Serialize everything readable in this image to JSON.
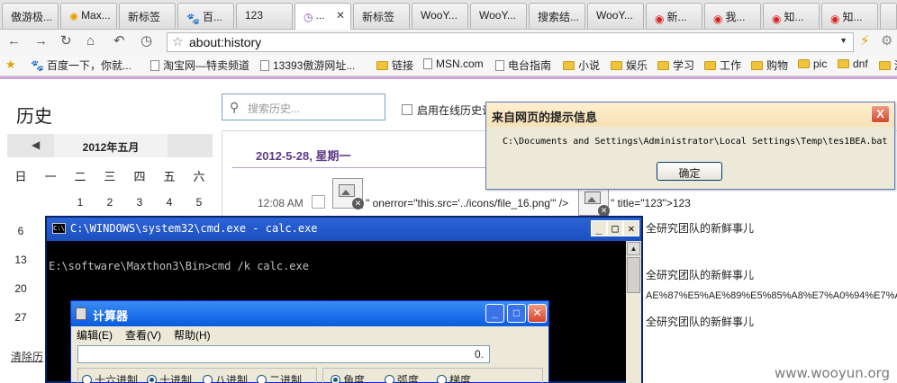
{
  "tabs": [
    {
      "label": "傲游极...",
      "icon": "favicon-icon"
    },
    {
      "label": "Max...",
      "icon": "maxthon-icon"
    },
    {
      "label": "新标签",
      "icon": ""
    },
    {
      "label": "百...",
      "icon": "baidu-paw-icon"
    },
    {
      "label": "123",
      "icon": ""
    },
    {
      "label": "...",
      "icon": "history-clock-icon",
      "active": true
    },
    {
      "label": "新标签",
      "icon": ""
    },
    {
      "label": "WooY...",
      "icon": ""
    },
    {
      "label": "WooY...",
      "icon": ""
    },
    {
      "label": "搜索结...",
      "icon": ""
    },
    {
      "label": "WooY...",
      "icon": ""
    },
    {
      "label": "新...",
      "icon": "weibo-icon"
    },
    {
      "label": "我...",
      "icon": "weibo-icon"
    },
    {
      "label": "知...",
      "icon": "weibo-icon"
    },
    {
      "label": "知...",
      "icon": "weibo-icon"
    }
  ],
  "navbar": {
    "url": "about:history"
  },
  "bookmarks": [
    {
      "label": "百度一下，你就...",
      "type": "baidu"
    },
    {
      "label": "淘宝网—特卖频道",
      "type": "page"
    },
    {
      "label": "13393傲游网址...",
      "type": "page"
    },
    {
      "label": "链接",
      "type": "folder"
    },
    {
      "label": "MSN.com",
      "type": "page"
    },
    {
      "label": "电台指南",
      "type": "page"
    },
    {
      "label": "小说",
      "type": "folder"
    },
    {
      "label": "娱乐",
      "type": "folder"
    },
    {
      "label": "学习",
      "type": "folder"
    },
    {
      "label": "工作",
      "type": "folder"
    },
    {
      "label": "购物",
      "type": "folder"
    },
    {
      "label": "pic",
      "type": "folder"
    },
    {
      "label": "dnf",
      "type": "folder"
    },
    {
      "label": "游",
      "type": "folder"
    }
  ],
  "history": {
    "title": "历史",
    "search_placeholder": "搜索历史...",
    "sync_label": "启用在线历史记",
    "clear_label": "清除历",
    "calendar": {
      "month": "2012年五月",
      "prev": "◀",
      "weekdays": [
        "日",
        "一",
        "二",
        "三",
        "四",
        "五",
        "六"
      ],
      "row1": [
        "1",
        "2",
        "3",
        "4",
        "5"
      ],
      "left_days": [
        "6",
        "13",
        "20",
        "27"
      ]
    },
    "date_heading": "2012-5-28, 星期一",
    "entry": {
      "time": "12:08 AM",
      "frag1": "\" onerror=\"this.src='../icons/file_16.png'\" />",
      "frag2": "\" title=\"123\">123"
    },
    "right_texts": [
      "全研究团队的新鲜事儿",
      "全研究团队的新鲜事儿",
      "AE%87%E5%AE%89%E5%85%A8%E7%A0%94%E7%A",
      "全研究团队的新鲜事儿"
    ]
  },
  "alert": {
    "title": "来自网页的提示信息",
    "message": "C:\\Documents and Settings\\Administrator\\Local Settings\\Temp\\tes1BEA.bat",
    "ok": "确定",
    "close": "X"
  },
  "cmd": {
    "title": "C:\\WINDOWS\\system32\\cmd.exe - calc.exe",
    "line1": "E:\\software\\Maxthon3\\Bin>cmd /k calc.exe"
  },
  "calc": {
    "title": "计算器",
    "menu": [
      "编辑(E)",
      "查看(V)",
      "帮助(H)"
    ],
    "display": "0.",
    "base": [
      "十六进制",
      "十进制",
      "八进制",
      "二进制"
    ],
    "angle": [
      "角度",
      "弧度",
      "梯度"
    ]
  },
  "watermark": "www.wooyun.org"
}
